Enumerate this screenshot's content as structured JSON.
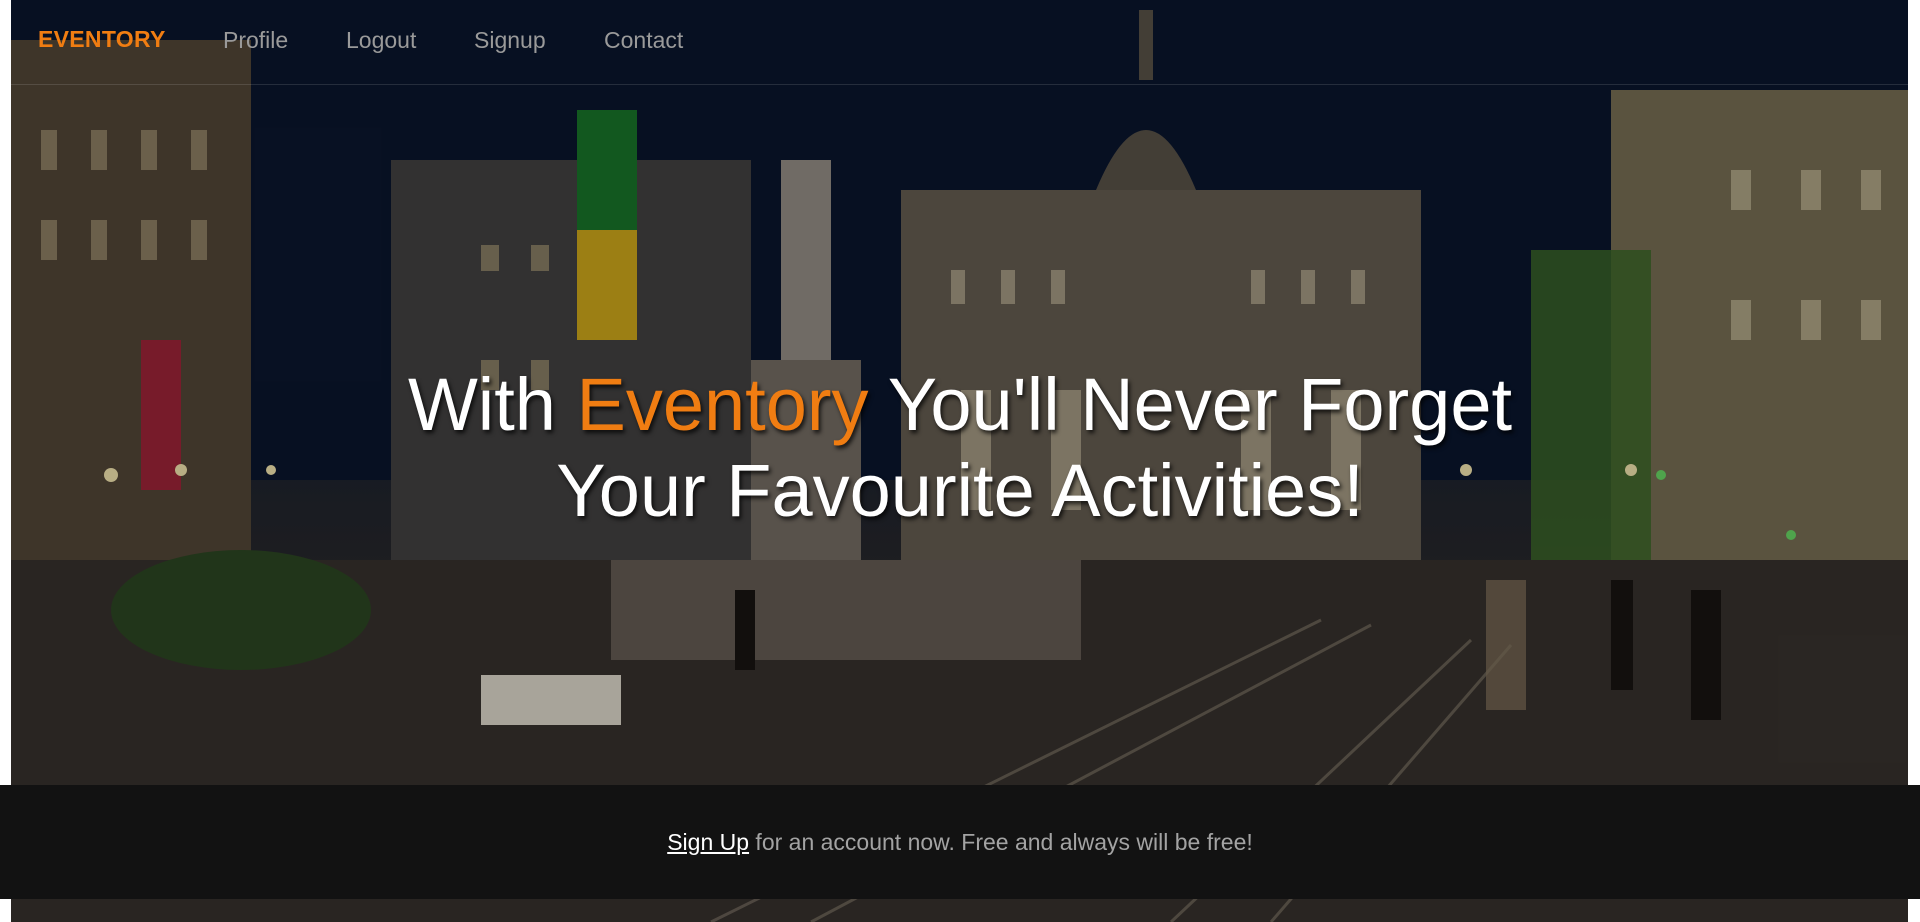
{
  "navbar": {
    "brand": "EVENTORY",
    "links": [
      {
        "label": "Profile"
      },
      {
        "label": "Logout"
      },
      {
        "label": "Signup"
      },
      {
        "label": "Contact"
      }
    ]
  },
  "hero": {
    "title_part1": "With ",
    "title_accent": "Eventory",
    "title_part2": " You'll Never Forget",
    "title_line2": "Your Favourite Activities!"
  },
  "signup_bar": {
    "link_label": "Sign Up",
    "text": " for an account now. Free and always will be free!"
  },
  "colors": {
    "accent": "#f07d12",
    "nav_text": "#9a9a9a",
    "bar_background": "#121212"
  }
}
